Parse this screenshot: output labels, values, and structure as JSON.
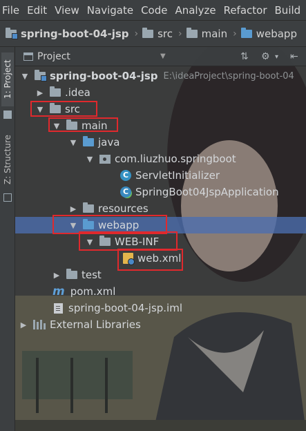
{
  "menu": [
    "File",
    "Edit",
    "View",
    "Navigate",
    "Code",
    "Analyze",
    "Refactor",
    "Build"
  ],
  "breadcrumb": [
    {
      "label": "spring-boot-04-jsp",
      "icon": "module-folder-icon"
    },
    {
      "label": "src",
      "icon": "folder-icon"
    },
    {
      "label": "main",
      "icon": "folder-icon"
    },
    {
      "label": "webapp",
      "icon": "web-folder-icon"
    }
  ],
  "tool_strip": {
    "project_tab": "1: Project",
    "structure_tab": "Z: Structure"
  },
  "panel": {
    "title": "Project"
  },
  "tree": [
    {
      "label": "spring-boot-04-jsp",
      "path": "E:\\ideaProject\\spring-boot-04",
      "icon": "module-folder-icon",
      "expanded": true
    },
    {
      "label": ".idea",
      "icon": "folder-icon",
      "expanded": false
    },
    {
      "label": "src",
      "icon": "folder-icon",
      "expanded": true
    },
    {
      "label": "main",
      "icon": "folder-icon",
      "expanded": true
    },
    {
      "label": "java",
      "icon": "source-folder-icon",
      "expanded": true
    },
    {
      "label": "com.liuzhuo.springboot",
      "icon": "package-icon",
      "expanded": true
    },
    {
      "label": "ServletInitializer",
      "icon": "class-icon"
    },
    {
      "label": "SpringBoot04JspApplication",
      "icon": "spring-boot-class-icon"
    },
    {
      "label": "resources",
      "icon": "resources-folder-icon",
      "expanded": false
    },
    {
      "label": "webapp",
      "icon": "web-folder-icon",
      "expanded": true,
      "selected": true
    },
    {
      "label": "WEB-INF",
      "icon": "folder-icon",
      "expanded": true
    },
    {
      "label": "web.xml",
      "icon": "web-xml-icon"
    },
    {
      "label": "test",
      "icon": "folder-icon",
      "expanded": false
    },
    {
      "label": "pom.xml",
      "icon": "maven-icon"
    },
    {
      "label": "spring-boot-04-jsp.iml",
      "icon": "iml-file-icon"
    },
    {
      "label": "External Libraries",
      "icon": "libraries-icon",
      "expanded": false
    }
  ],
  "colors": {
    "selection": "#4b6eaf",
    "highlight_box": "#e0292d",
    "chrome": "#3c3f41"
  }
}
